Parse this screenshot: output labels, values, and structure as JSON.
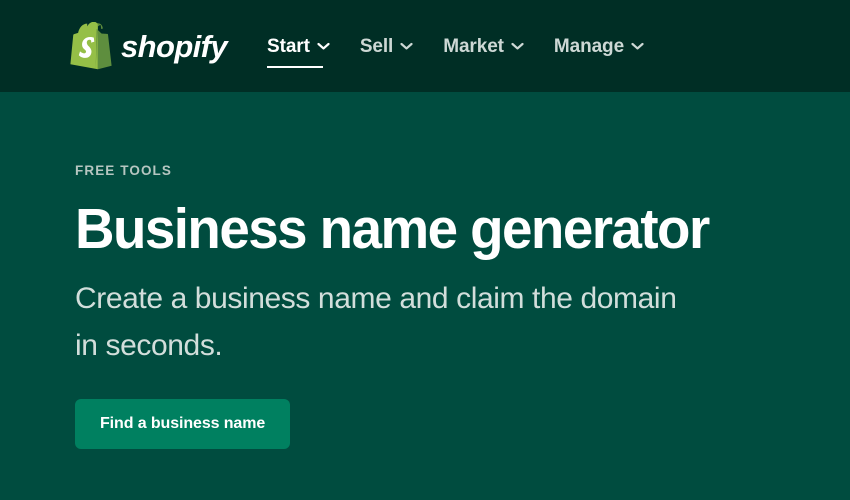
{
  "header": {
    "brand": {
      "logo_icon": "shopify-bag-icon",
      "wordmark": "shopify"
    },
    "nav": [
      {
        "label": "Start",
        "icon": "chevron-down-icon",
        "active": true
      },
      {
        "label": "Sell",
        "icon": "chevron-down-icon",
        "active": false
      },
      {
        "label": "Market",
        "icon": "chevron-down-icon",
        "active": false
      },
      {
        "label": "Manage",
        "icon": "chevron-down-icon",
        "active": false
      }
    ]
  },
  "hero": {
    "eyebrow": "FREE TOOLS",
    "headline": "Business name generator",
    "subheading": "Create a business name and claim the domain in seconds.",
    "cta_label": "Find a business name"
  },
  "colors": {
    "header_background": "#002e25",
    "page_background": "#004c3f",
    "cta_background": "#008060",
    "logo_green": "#95bf47",
    "logo_green_dark": "#5e8e3e",
    "text_primary": "#ffffff",
    "text_muted": "#cdd8d5"
  }
}
